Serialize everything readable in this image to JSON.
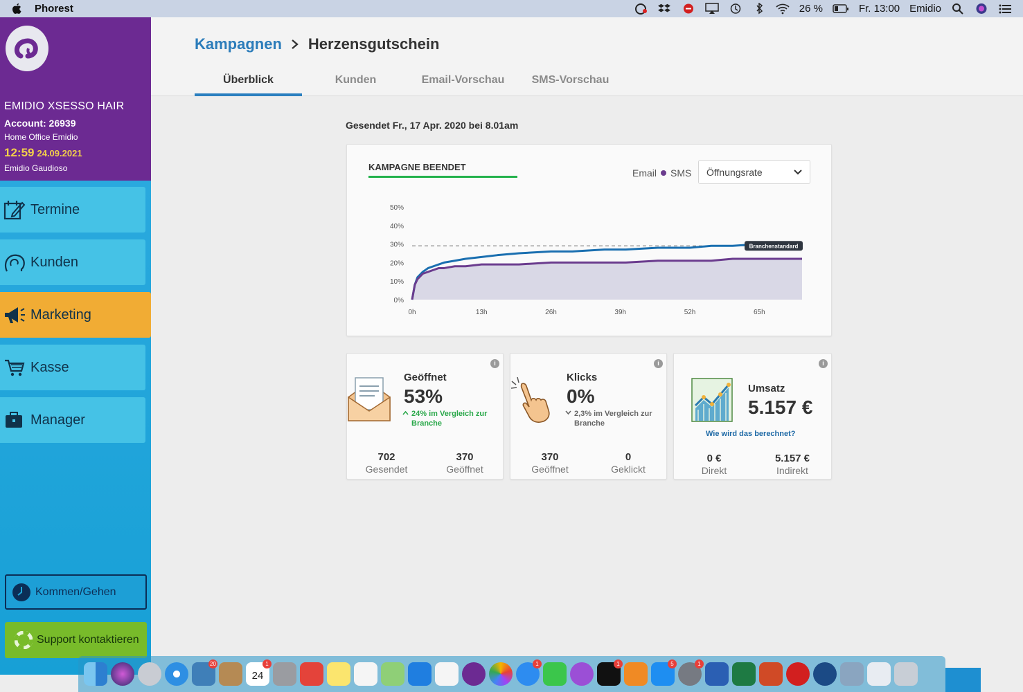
{
  "menubar": {
    "app_name": "Phorest",
    "battery": "26 %",
    "clock": "Fr. 13:00",
    "user": "Emidio",
    "icons": [
      "apple-icon",
      "creative-cloud-icon",
      "dropbox-icon",
      "stop-icon",
      "airplay-icon",
      "time-machine-icon",
      "bluetooth-icon",
      "wifi-icon",
      "battery-icon",
      "spotlight-icon",
      "siri-icon",
      "notification-center-icon"
    ]
  },
  "sidebar": {
    "business": "EMIDIO XSESSO HAIR",
    "account": "Account: 26939",
    "location": "Home Office Emidio",
    "time": "12:59",
    "date": "24.09.2021",
    "user": "Emidio Gaudioso",
    "nav": [
      {
        "label": "Termine",
        "icon": "calendar-edit-icon"
      },
      {
        "label": "Kunden",
        "icon": "customer-head-icon"
      },
      {
        "label": "Marketing",
        "icon": "megaphone-icon"
      },
      {
        "label": "Kasse",
        "icon": "cart-icon"
      },
      {
        "label": "Manager",
        "icon": "briefcase-icon"
      }
    ],
    "clock_button": "Kommen/Gehen",
    "support_button": "Support kontaktieren"
  },
  "header": {
    "breadcrumb_parent": "Kampagnen",
    "breadcrumb_current": "Herzensgutschein",
    "tabs": [
      "Überblick",
      "Kunden",
      "Email-Vorschau",
      "SMS-Vorschau"
    ]
  },
  "main": {
    "sent_line": "Gesendet Fr., 17 Apr. 2020 bei 8.01am",
    "chart_card": {
      "status": "KAMPAGNE BEENDET",
      "legend_email": "Email",
      "legend_sms": "SMS",
      "metric_select": "Öffnungsrate"
    },
    "stats": {
      "opened": {
        "label": "Geöffnet",
        "value": "53%",
        "compare": "24% im Vergleich zur Branche",
        "sent_num": "702",
        "sent_label": "Gesendet",
        "opened_num": "370",
        "opened_label": "Geöffnet"
      },
      "clicks": {
        "label": "Klicks",
        "value": "0%",
        "compare": "2,3% im Vergleich zur Branche",
        "opened_num": "370",
        "opened_label": "Geöffnet",
        "clicked_num": "0",
        "clicked_label": "Geklickt"
      },
      "revenue": {
        "label": "Umsatz",
        "value": "5.157 €",
        "link": "Wie wird das berechnet?",
        "direct_num": "0 €",
        "direct_label": "Direkt",
        "indirect_num": "5.157 €",
        "indirect_label": "Indirekt"
      }
    }
  },
  "chart_data": {
    "type": "line",
    "x_ticks": [
      "0h",
      "13h",
      "26h",
      "39h",
      "52h",
      "65h"
    ],
    "y_ticks": [
      "0%",
      "10%",
      "20%",
      "30%",
      "40%",
      "50%"
    ],
    "xlim": [
      0,
      73
    ],
    "ylim": [
      0,
      50
    ],
    "reference_label": "Branchenstandard",
    "reference_value": 29,
    "series": [
      {
        "color": "#1a6fb0",
        "x": [
          0,
          0.5,
          1,
          2,
          3,
          4,
          5,
          6,
          8,
          10,
          13,
          16,
          20,
          26,
          30,
          36,
          40,
          46,
          52,
          56,
          60,
          65,
          73
        ],
        "y": [
          0,
          8,
          12,
          15,
          17,
          18,
          19,
          20,
          21,
          22,
          23,
          24,
          25,
          26,
          26,
          27,
          27,
          28,
          28,
          29,
          29,
          30,
          30
        ]
      },
      {
        "color": "#6b3c8e",
        "x": [
          0,
          0.5,
          1,
          2,
          3,
          4,
          5,
          6,
          8,
          10,
          13,
          16,
          20,
          26,
          30,
          36,
          40,
          46,
          52,
          56,
          60,
          65,
          73
        ],
        "y": [
          0,
          8,
          11,
          14,
          15,
          16,
          17,
          17,
          18,
          18,
          19,
          19,
          19,
          20,
          20,
          20,
          20,
          21,
          21,
          21,
          22,
          22,
          22
        ]
      }
    ]
  },
  "dock": {
    "badges": {
      "mail": "20",
      "calendar": "1",
      "calendar_day": "24",
      "messages": "1",
      "tv": "1",
      "appstore": "5",
      "prefs": "1"
    }
  }
}
